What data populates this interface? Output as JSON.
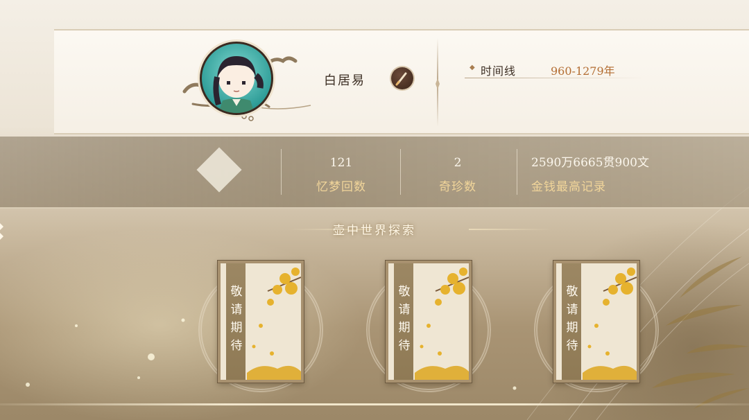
{
  "profile": {
    "name": "白居易",
    "timeline_label": "时间线",
    "timeline_value": "960-1279年"
  },
  "stats": [
    {
      "value": "121",
      "label": "忆梦回数"
    },
    {
      "value": "2",
      "label": "奇珍数"
    },
    {
      "value": "2590万6665贯900文",
      "label": "金钱最高记录"
    }
  ],
  "exploration": {
    "title": "壶中世界探索",
    "cards": [
      {
        "text": "敬\n请\n期\n待"
      },
      {
        "text": "敬\n请\n期\n待"
      },
      {
        "text": "敬\n请\n期\n待"
      }
    ]
  },
  "colors": {
    "accent": "#b36d32",
    "stat_label": "#f1d59a",
    "avatar_ring": "#2f9d98"
  },
  "icons": {
    "edit": "brush-icon",
    "timeline_bullet": "diamond-bullet-icon"
  }
}
